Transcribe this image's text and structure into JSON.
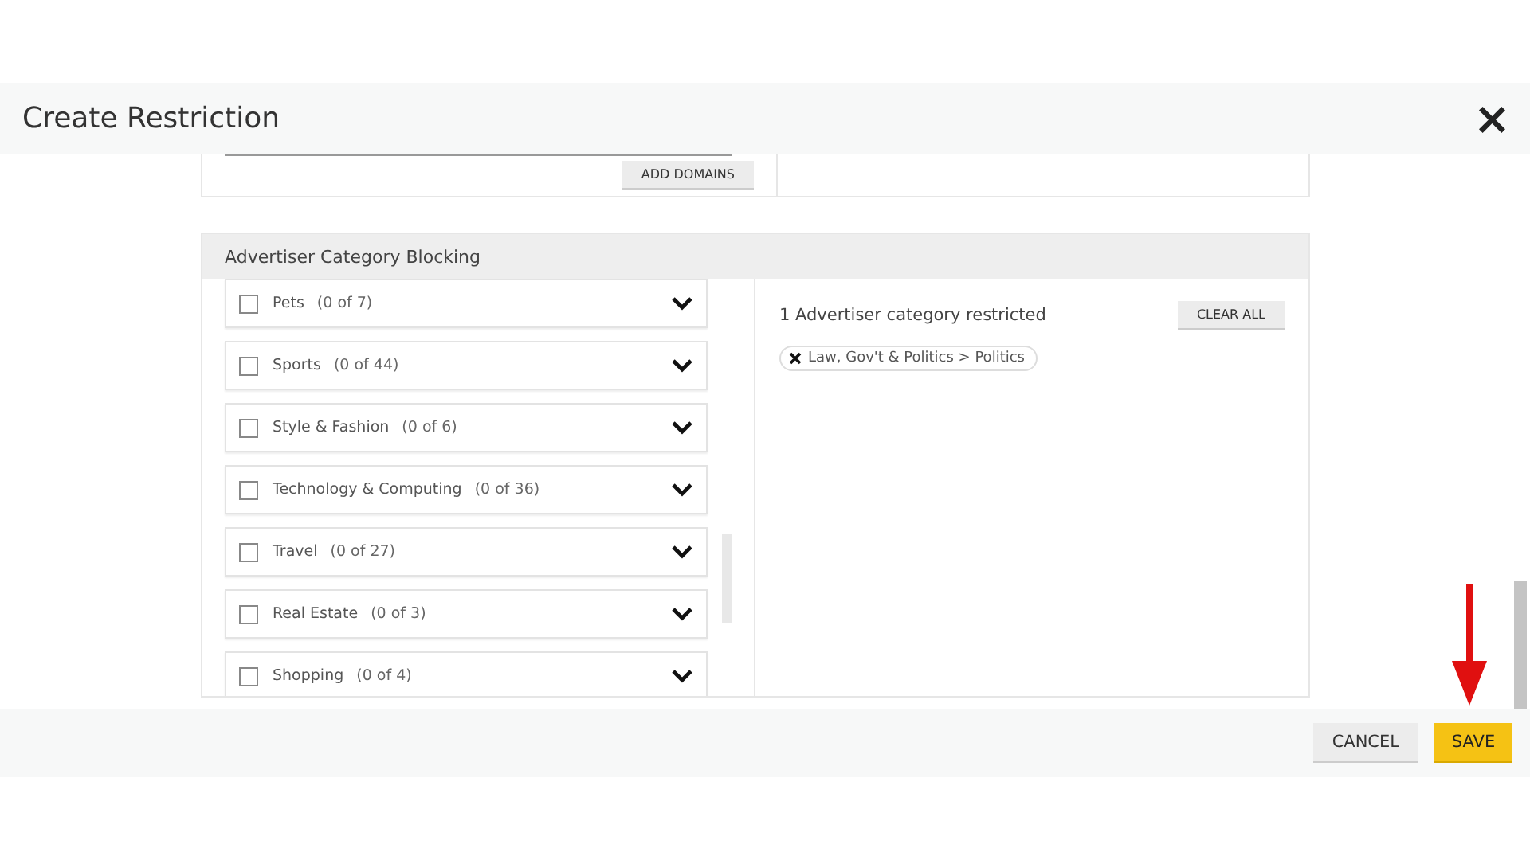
{
  "dialog": {
    "title": "Create Restriction",
    "close": "×"
  },
  "domains": {
    "add_button": "ADD DOMAINS"
  },
  "section": {
    "title": "Advertiser Category Blocking",
    "categories": [
      {
        "name": "Pets",
        "count": "(0 of 7)",
        "checked": false
      },
      {
        "name": "Sports",
        "count": "(0 of 44)",
        "checked": false
      },
      {
        "name": "Style & Fashion",
        "count": "(0 of 6)",
        "checked": false
      },
      {
        "name": "Technology & Computing",
        "count": "(0 of 36)",
        "checked": false
      },
      {
        "name": "Travel",
        "count": "(0 of 27)",
        "checked": false
      },
      {
        "name": "Real Estate",
        "count": "(0 of 3)",
        "checked": false
      },
      {
        "name": "Shopping",
        "count": "(0 of 4)",
        "checked": false
      }
    ],
    "summary": "1 Advertiser category restricted",
    "clear_button": "CLEAR ALL",
    "chips": [
      {
        "label": "Law, Gov't & Politics > Politics"
      }
    ]
  },
  "footer": {
    "buttons": [
      {
        "label": "CANCEL",
        "kind": "secondary"
      },
      {
        "label": "SAVE",
        "kind": "primary"
      }
    ]
  }
}
